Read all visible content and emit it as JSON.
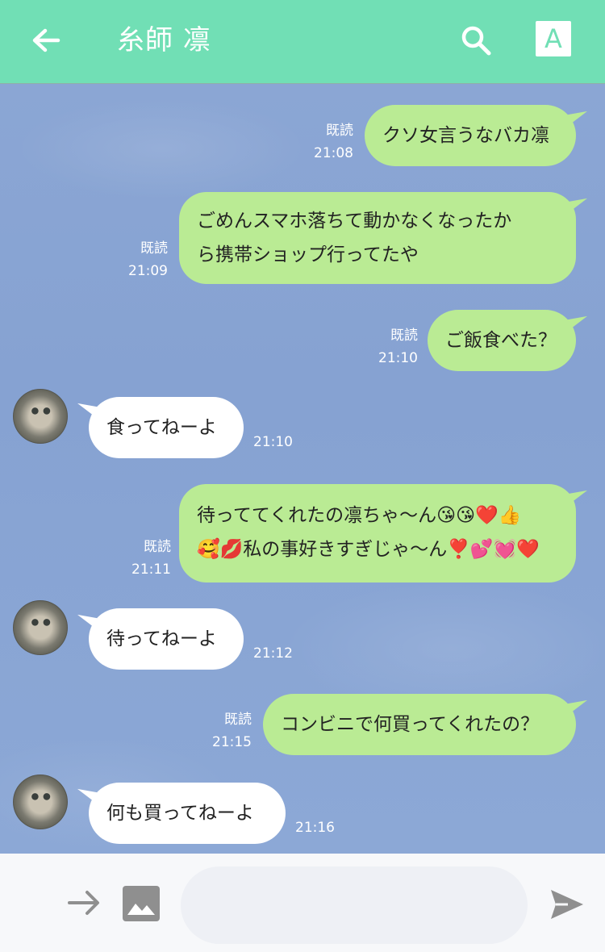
{
  "header": {
    "title": "糸師 凛",
    "font_button_label": "A"
  },
  "messages": [
    {
      "side": "out",
      "text": "クソ女言うなバカ凛",
      "read": "既読",
      "time": "21:08"
    },
    {
      "side": "out",
      "text": "ごめんスマホ落ちて動かなくなったか\nら携帯ショップ行ってたや",
      "read": "既読",
      "time": "21:09"
    },
    {
      "side": "out",
      "text": "ご飯食べた？",
      "read": "既読",
      "time": "21:10"
    },
    {
      "side": "in",
      "text": "食ってねーよ",
      "time": "21:10"
    },
    {
      "side": "out",
      "text": "待っててくれたの凛ちゃ〜ん😘😘❤️👍\n🥰💋私の事好きすぎじゃ〜ん❣️💕💓❤️",
      "read": "既読",
      "time": "21:11"
    },
    {
      "side": "in",
      "text": "待ってねーよ",
      "time": "21:12"
    },
    {
      "side": "out",
      "text": "コンビニで何買ってくれたの？",
      "read": "既読",
      "time": "21:15"
    },
    {
      "side": "in",
      "text": "何も買ってねーよ",
      "time": "21:16"
    }
  ],
  "composer": {
    "placeholder": ""
  },
  "colors": {
    "header_bg": "#71dfb5",
    "outgoing_bubble": "#baeb94",
    "incoming_bubble": "#ffffff",
    "chat_bg": "#8aa6d2"
  },
  "icons": [
    "back-arrow-icon",
    "search-icon",
    "font-size-icon",
    "forward-arrow-icon",
    "image-icon",
    "send-icon"
  ]
}
